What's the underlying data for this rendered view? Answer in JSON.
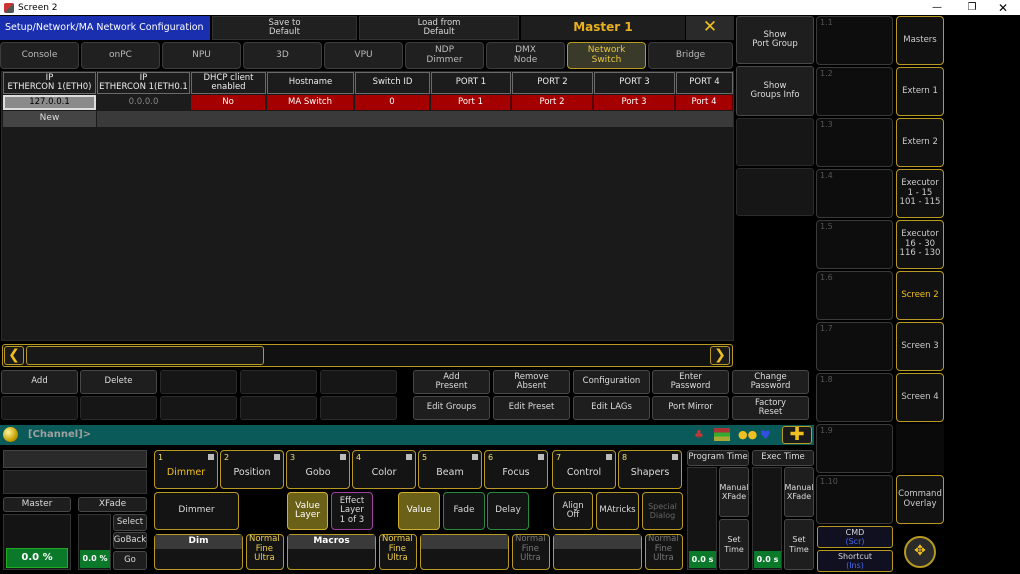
{
  "window": {
    "title": "Screen 2"
  },
  "header": {
    "breadcrumb": "Setup/Network/MA Network Configuration",
    "save": "Save to\nDefault",
    "load": "Load from\nDefault",
    "master": "Master 1",
    "close": "✕"
  },
  "tabs": [
    "Console",
    "onPC",
    "NPU",
    "3D",
    "VPU",
    "NDP\nDimmer",
    "DMX\nNode",
    "Network\nSwitch",
    "Bridge"
  ],
  "table": {
    "headers": [
      "IP\nETHERCON 1(ETH0)",
      "IP\nETHERCON 1(ETH0.1",
      "DHCP client\nenabled",
      "Hostname",
      "Switch ID",
      "PORT 1",
      "PORT 2",
      "PORT 3",
      "PORT 4"
    ],
    "row": [
      "127.0.0.1",
      "0.0.0.0",
      "No",
      "MA Switch",
      "0",
      "Port 1",
      "Port 2",
      "Port 3",
      "Port 4"
    ],
    "new": "New"
  },
  "actions": {
    "add": "Add",
    "delete": "Delete",
    "add_present": "Add\nPresent",
    "remove_absent": "Remove\nAbsent",
    "configuration": "Configuration",
    "enter_password": "Enter\nPassword",
    "change_password": "Change\nPassword",
    "edit_groups": "Edit Groups",
    "edit_preset": "Edit Preset",
    "edit_lags": "Edit LAGs",
    "port_mirror": "Port Mirror",
    "factory_reset": "Factory\nReset"
  },
  "mid": {
    "show_port_group": "Show\nPort Group",
    "show_groups_info": "Show\nGroups Info"
  },
  "viewgrid": [
    "1.1",
    "1.2",
    "1.3",
    "1.4",
    "1.5",
    "1.6",
    "1.7",
    "1.8",
    "1.9",
    "1.10"
  ],
  "sidebar": [
    "Masters",
    "Extern 1",
    "Extern 2",
    "Executor\n1 - 15\n101 - 115",
    "Executor\n16 - 30\n116 - 130",
    "Screen 2",
    "Screen 3",
    "Screen 4",
    "",
    "Command\nOverlay"
  ],
  "cmdline": {
    "text": "[Channel]>"
  },
  "bottom": {
    "master_label": "Master",
    "master_value": "0.0 %",
    "xfade_label": "XFade",
    "xfade_value": "0.0 %",
    "select": "Select",
    "goback": "GoBack",
    "go": "Go",
    "presets": [
      {
        "n": "1",
        "l": "Dimmer"
      },
      {
        "n": "2",
        "l": "Position"
      },
      {
        "n": "3",
        "l": "Gobo"
      },
      {
        "n": "4",
        "l": "Color"
      },
      {
        "n": "5",
        "l": "Beam"
      },
      {
        "n": "6",
        "l": "Focus"
      },
      {
        "n": "7",
        "l": "Control"
      },
      {
        "n": "8",
        "l": "Shapers"
      }
    ],
    "dimmer": "Dimmer",
    "value_layer": "Value\nLayer",
    "effect_layer": "Effect\nLayer\n1 of 3",
    "value": "Value",
    "fade": "Fade",
    "delay": "Delay",
    "align": "Align\nOff",
    "matricks": "MAtricks",
    "special": "Special\nDialog",
    "enc1": "Dim",
    "enc2": "Macros",
    "nfu": "Normal\nFine\nUltra",
    "program_time": "Program Time",
    "exec_time": "Exec Time",
    "manual_xfade": "Manual\nXFade",
    "set_time": "Set\nTime",
    "time_val": "0.0 s",
    "cmd": "CMD",
    "cmd_sub": "(Scr)",
    "shortcut": "Shortcut",
    "shortcut_sub": "(Ins)"
  },
  "colors": {
    "accent": "#b89a22",
    "header_blue": "#1a2fb0",
    "row_red": "#a40000",
    "cmd_teal": "#0a5a5a",
    "value_green": "#0a7a2a"
  }
}
